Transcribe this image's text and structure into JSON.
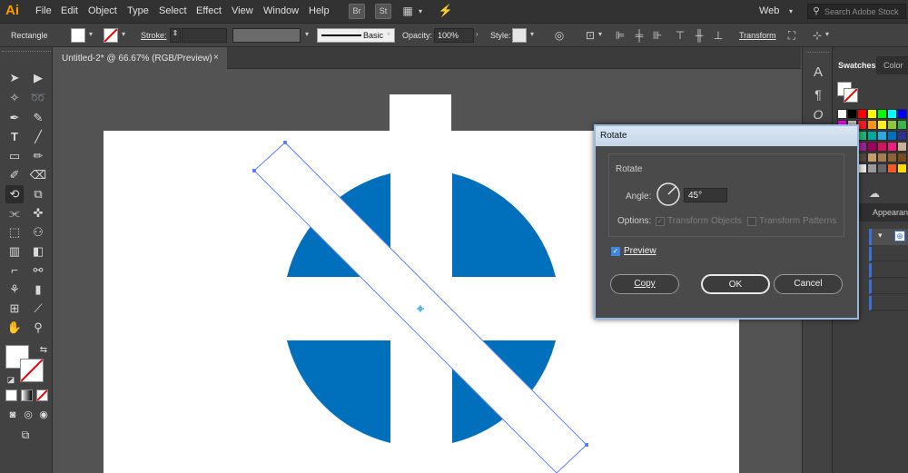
{
  "app": {
    "logo": "Ai"
  },
  "menu": [
    "File",
    "Edit",
    "Object",
    "Type",
    "Select",
    "Effect",
    "View",
    "Window",
    "Help"
  ],
  "app_icons": [
    "Br",
    "St"
  ],
  "workspace": {
    "label": "Web"
  },
  "search": {
    "placeholder": "Search Adobe Stock"
  },
  "control": {
    "tool_name": "Rectangle",
    "stroke_label": "Stroke:",
    "brush_label": "Basic",
    "opacity_label": "Opacity:",
    "opacity_value": "100%",
    "style_label": "Style:",
    "transform_label": "Transform"
  },
  "document": {
    "tab_title": "Untitled-2* @ 66.67% (RGB/Preview)",
    "close": "×"
  },
  "panels": {
    "swatches_tab": "Swatches",
    "color_tab": "Color",
    "appearance_tab": "Appearance"
  },
  "rotate_dialog": {
    "title": "Rotate",
    "section": "Rotate",
    "angle_label": "Angle:",
    "angle_value": "45°",
    "options_label": "Options:",
    "transform_objects": "Transform Objects",
    "transform_patterns": "Transform Patterns",
    "preview": "Preview",
    "copy": "Copy",
    "ok": "OK",
    "cancel": "Cancel",
    "preview_checked": true
  },
  "colors": {
    "accent_blue": "#0070bd",
    "selection_blue": "#5b7fff",
    "app_orange": "#ff9a00"
  },
  "swatch_colors": [
    "#ffffff",
    "#000000",
    "#ff0000",
    "#ffff00",
    "#00ff00",
    "#00ffff",
    "#0000ff",
    "#ff00ff",
    "#c8c8c8",
    "#ed1c24",
    "#f7931e",
    "#fcee21",
    "#8cc63f",
    "#39b54a",
    "#009245",
    "#006837",
    "#22b573",
    "#00a99d",
    "#29abe2",
    "#0071bc",
    "#2e3192",
    "#1b1464",
    "#662d91",
    "#93278f",
    "#9e005d",
    "#d4145a",
    "#ed1e79",
    "#c7b299",
    "#998675",
    "#736357",
    "#534741",
    "#c69c6d",
    "#a67c52",
    "#8c6239",
    "#754c24",
    "#603813",
    "#f2f2f2",
    "#e6e6e6",
    "#999999",
    "#666666",
    "#f15a24",
    "#ffdd00",
    "#fbb03b",
    "#ed8eb6"
  ]
}
